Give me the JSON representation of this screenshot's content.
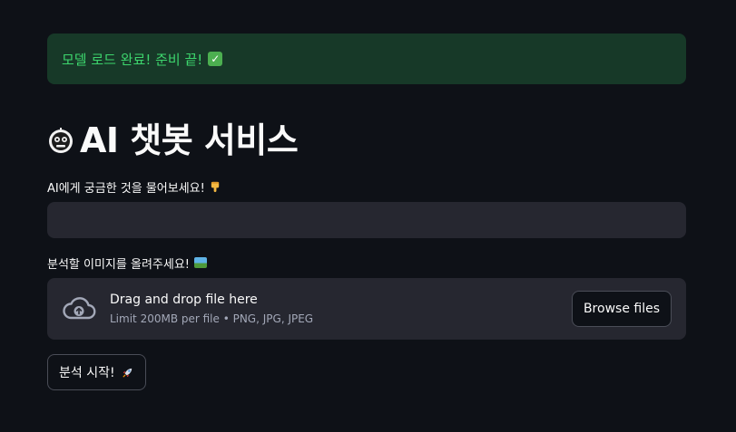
{
  "colors": {
    "background": "#0e1117",
    "success_bg": "#173928",
    "success_text": "#3dd56d",
    "input_bg": "#262730",
    "button_border": "#4a4d57"
  },
  "alert": {
    "text": "모델 로드 완료! 준비 끝!",
    "icon": "check-mark-button-icon"
  },
  "header": {
    "title": "AI 챗봇 서비스",
    "icon": "robot-face-icon"
  },
  "question": {
    "label": "AI에게 궁금한 것을 물어보세요!",
    "label_icon": "backhand-index-pointing-down-icon",
    "value": "",
    "placeholder": ""
  },
  "uploader": {
    "label": "분석할 이미지를 올려주세요!",
    "label_icon": "framed-picture-icon",
    "drop_title": "Drag and drop file here",
    "limit_text": "Limit 200MB per file • PNG, JPG, JPEG",
    "browse_label": "Browse files",
    "icon": "cloud-upload-icon"
  },
  "actions": {
    "start_label": "분석 시작!",
    "start_icon": "rocket-icon"
  }
}
